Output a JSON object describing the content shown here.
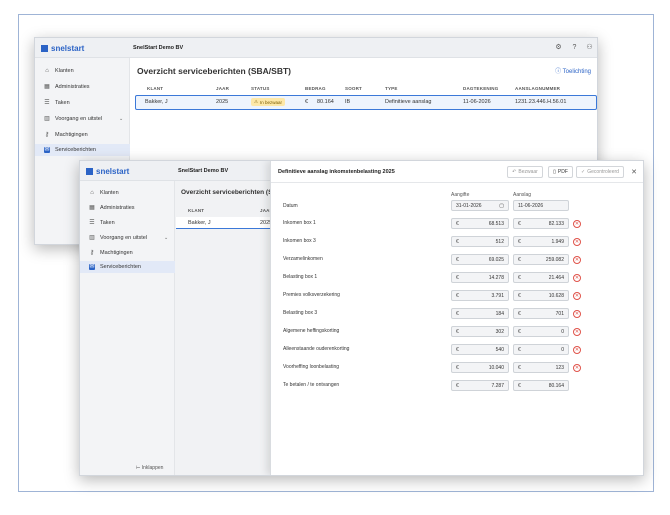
{
  "app": {
    "logo_text": "snelstart",
    "company": "SnelStart Demo BV",
    "brand_color": "#2b63c6"
  },
  "sidebar": {
    "items": [
      {
        "label": "Klanten",
        "icon": "home-icon"
      },
      {
        "label": "Administraties",
        "icon": "building-icon"
      },
      {
        "label": "Taken",
        "icon": "list-icon"
      },
      {
        "label": "Voorgang en uitstel",
        "icon": "chart-icon"
      },
      {
        "label": "Machtigingen",
        "icon": "key-icon"
      },
      {
        "label": "Serviceberichten",
        "icon": "mail-icon"
      }
    ],
    "collapse_label": "Inklappen"
  },
  "overview": {
    "title": "Overzicht serviceberichten (SBA/SBT)",
    "title_short": "Overzicht serviceberichten (S",
    "help_label": "Toelichting",
    "columns": [
      "KLANT",
      "JAAR",
      "STATUS",
      "BEDRAG",
      "SOORT",
      "TYPE",
      "DAGTEKENING",
      "AANSLAGNUMMER"
    ],
    "row": {
      "klant": "Bakker, J",
      "jaar": "2025",
      "status": "In bezwaar",
      "currency": "€",
      "bedrag": "80.164",
      "soort": "IB",
      "type": "Definitieve aanslag",
      "dagtekening": "11-06-2026",
      "aanslagnummer": "1231.23.446.H.56.01"
    }
  },
  "dialog": {
    "title": "Definitieve aanslag inkomstenbelasting 2025",
    "buttons": {
      "bezwaar": "Bezwaar",
      "pdf": "PDF",
      "gecontroleerd": "Gecontroleerd"
    },
    "col_aangifte": "Aangifte",
    "col_aanslag": "Aanslag",
    "datum_label": "Datum",
    "datum_aangifte": "31-01-2026",
    "datum_aanslag": "11-06-2026",
    "currency": "€",
    "rows": [
      {
        "label": "Inkomen box 1",
        "aangifte": "68.513",
        "aanslag": "82.133"
      },
      {
        "label": "Inkomen box 3",
        "aangifte": "512",
        "aanslag": "1.949"
      },
      {
        "label": "Verzamelinkomen",
        "aangifte": "69.025",
        "aanslag": "259.082"
      },
      {
        "label": "Belasting box 1",
        "aangifte": "14.278",
        "aanslag": "21.464"
      },
      {
        "label": "Premies volksverzekering",
        "aangifte": "3.791",
        "aanslag": "10.628"
      },
      {
        "label": "Belasting box 3",
        "aangifte": "184",
        "aanslag": "701"
      },
      {
        "label": "Algemene heffingskorting",
        "aangifte": "302",
        "aanslag": "0"
      },
      {
        "label": "Alleenstaande ouderenkorting",
        "aangifte": "540",
        "aanslag": "0"
      },
      {
        "label": "Voorheffing loonbelasting",
        "aangifte": "10.040",
        "aanslag": "123"
      },
      {
        "label": "Te betalen / te ontvangen",
        "aangifte": "7.287",
        "aanslag": "80.164"
      }
    ]
  }
}
